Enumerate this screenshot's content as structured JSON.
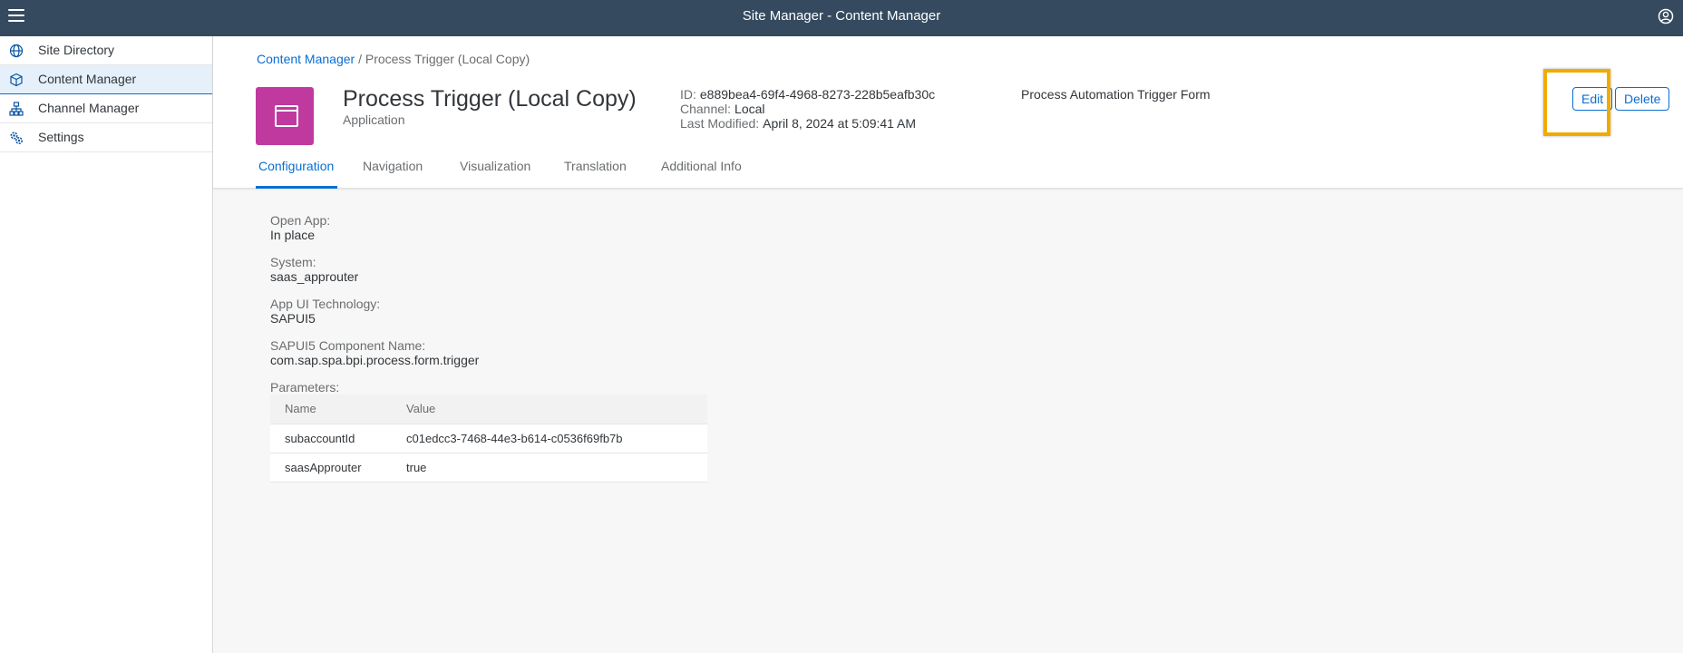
{
  "shell": {
    "title": "Site Manager - Content Manager"
  },
  "sidebar": {
    "items": [
      {
        "label": "Site Directory",
        "icon": "globe-icon"
      },
      {
        "label": "Content Manager",
        "icon": "cube-icon",
        "selected": true
      },
      {
        "label": "Channel Manager",
        "icon": "hierarchy-icon"
      },
      {
        "label": "Settings",
        "icon": "gears-icon"
      }
    ]
  },
  "header": {
    "breadcrumb": {
      "link": "Content Manager",
      "separator": "/",
      "current": "Process Trigger (Local Copy)"
    },
    "title": "Process Trigger (Local Copy)",
    "subtitle": "Application",
    "attributes": {
      "id_label": "ID:",
      "id_value": "e889bea4-69f4-4968-8273-228b5eafb30c",
      "channel_label": "Channel:",
      "channel_value": "Local",
      "modified_label": "Last Modified:",
      "modified_value": "April 8, 2024 at 5:09:41 AM"
    },
    "description": "Process Automation Trigger Form",
    "actions": {
      "edit": "Edit",
      "delete": "Delete"
    },
    "accent_color": "#c0399f",
    "highlight_color": "#f0ab00"
  },
  "tabs": [
    "Configuration",
    "Navigation",
    "Visualization",
    "Translation",
    "Additional Info"
  ],
  "configuration": {
    "open_app_label": "Open App:",
    "open_app_value": "In place",
    "system_label": "System:",
    "system_value": "saas_approuter",
    "tech_label": "App UI Technology:",
    "tech_value": "SAPUI5",
    "component_label": "SAPUI5 Component Name:",
    "component_value": "com.sap.spa.bpi.process.form.trigger",
    "parameters_label": "Parameters:",
    "parameters": {
      "columns": [
        "Name",
        "Value"
      ],
      "rows": [
        [
          "subaccountId",
          "c01edcc3-7468-44e3-b614-c0536f69fb7b"
        ],
        [
          "saasApprouter",
          "true"
        ]
      ]
    }
  }
}
